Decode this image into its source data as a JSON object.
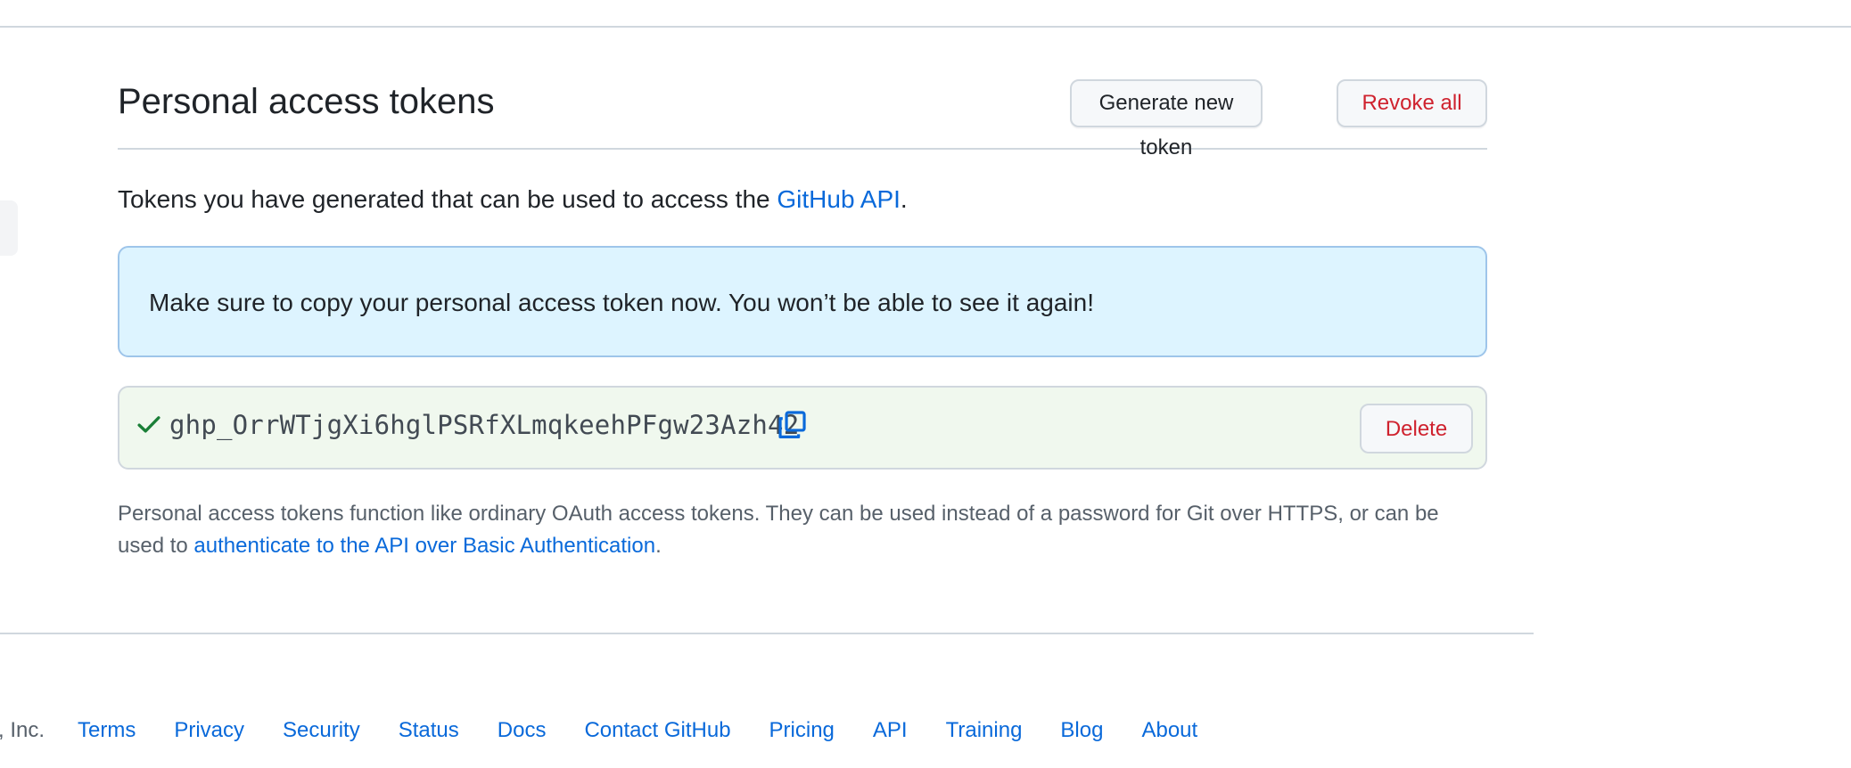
{
  "header": {
    "title": "Personal access tokens",
    "generate_label": "Generate new token",
    "revoke_label": "Revoke all"
  },
  "intro": {
    "text_before": "Tokens you have generated that can be used to access the ",
    "link_text": "GitHub API",
    "text_after": "."
  },
  "flash": {
    "message": "Make sure to copy your personal access token now. You won’t be able to see it again!"
  },
  "token": {
    "value": "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",
    "delete_label": "Delete",
    "status_icon": "check-icon",
    "copy_icon": "copy-icon"
  },
  "note": {
    "text_before": "Personal access tokens function like ordinary OAuth access tokens. They can be used instead of a password for Git over HTTPS, or can be used to ",
    "link_text": "authenticate to the API over Basic Authentication",
    "text_after": "."
  },
  "footer": {
    "copyright_fragment": ", Inc.",
    "links": [
      "Terms",
      "Privacy",
      "Security",
      "Status",
      "Docs",
      "Contact GitHub",
      "Pricing",
      "API",
      "Training",
      "Blog",
      "About"
    ]
  },
  "colors": {
    "accent_link": "#0969da",
    "danger": "#cf222e",
    "success": "#1a7f37",
    "flash_bg": "#ddf4ff",
    "token_bg": "#f0f8ee"
  }
}
